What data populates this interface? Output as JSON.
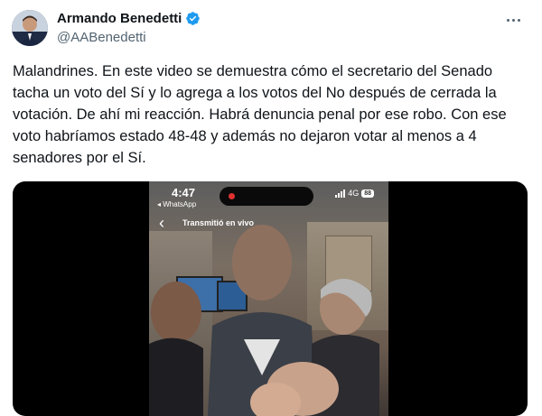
{
  "author": {
    "name": "Armando Benedetti",
    "handle": "@AABenedetti",
    "verified": true
  },
  "menu_icon": "more-horizontal-icon",
  "tweet": {
    "text": "Malandrines. En este video se demuestra cómo el secretario del Senado tacha un voto del Sí y lo agrega a los votos del No después de cerrada la votación. De ahí mi reacción. Habrá denuncia penal por ese robo. Con ese voto habríamos estado 48-48 y además no dejaron votar al menos a 4 senadores por el Sí."
  },
  "video": {
    "status_time": "4:47",
    "back_app": "◂ WhatsApp",
    "network": "4G",
    "battery": "88",
    "live_label": "Transmitió en vivo"
  },
  "colors": {
    "text": "#0f1419",
    "secondary": "#536471",
    "verified": "#1d9bf0",
    "record": "#e0312f"
  }
}
